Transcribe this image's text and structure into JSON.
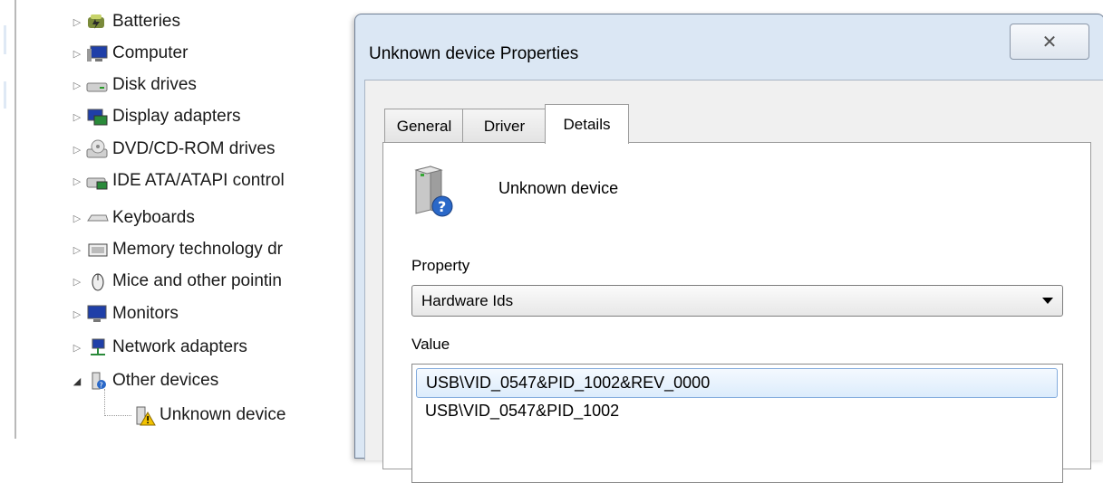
{
  "device_tree": {
    "items": [
      {
        "label": "Batteries",
        "icon": "battery-icon",
        "expander": "collapsed"
      },
      {
        "label": "Computer",
        "icon": "computer-icon",
        "expander": "collapsed"
      },
      {
        "label": "Disk drives",
        "icon": "disk-drive-icon",
        "expander": "collapsed"
      },
      {
        "label": "Display adapters",
        "icon": "display-adapter-icon",
        "expander": "collapsed"
      },
      {
        "label": "DVD/CD-ROM drives",
        "icon": "dvd-drive-icon",
        "expander": "collapsed"
      },
      {
        "label": "IDE ATA/ATAPI control",
        "icon": "ide-controller-icon",
        "expander": "collapsed"
      },
      {
        "label": "Keyboards",
        "icon": "keyboard-icon",
        "expander": "collapsed"
      },
      {
        "label": "Memory technology dr",
        "icon": "memory-icon",
        "expander": "collapsed"
      },
      {
        "label": "Mice and other pointin",
        "icon": "mouse-icon",
        "expander": "collapsed"
      },
      {
        "label": "Monitors",
        "icon": "monitor-icon",
        "expander": "collapsed"
      },
      {
        "label": "Network adapters",
        "icon": "network-adapter-icon",
        "expander": "collapsed"
      },
      {
        "label": "Other devices",
        "icon": "other-devices-icon",
        "expander": "expanded"
      }
    ],
    "child": {
      "label": "Unknown device",
      "icon": "unknown-device-warning-icon"
    }
  },
  "dialog": {
    "title": "Unknown device Properties",
    "close_glyph": "✕",
    "tabs": [
      {
        "label": "General",
        "active": false
      },
      {
        "label": "Driver",
        "active": false
      },
      {
        "label": "Details",
        "active": true
      }
    ],
    "device_name": "Unknown device",
    "property_label": "Property",
    "property_value": "Hardware Ids",
    "value_label": "Value",
    "values": [
      "USB\\VID_0547&PID_1002&REV_0000",
      "USB\\VID_0547&PID_1002"
    ],
    "selected_value_index": 0
  },
  "colors": {
    "dialog_frame": "#dbe7f4",
    "selection": "#dcecfc",
    "selection_border": "#84acdd"
  }
}
